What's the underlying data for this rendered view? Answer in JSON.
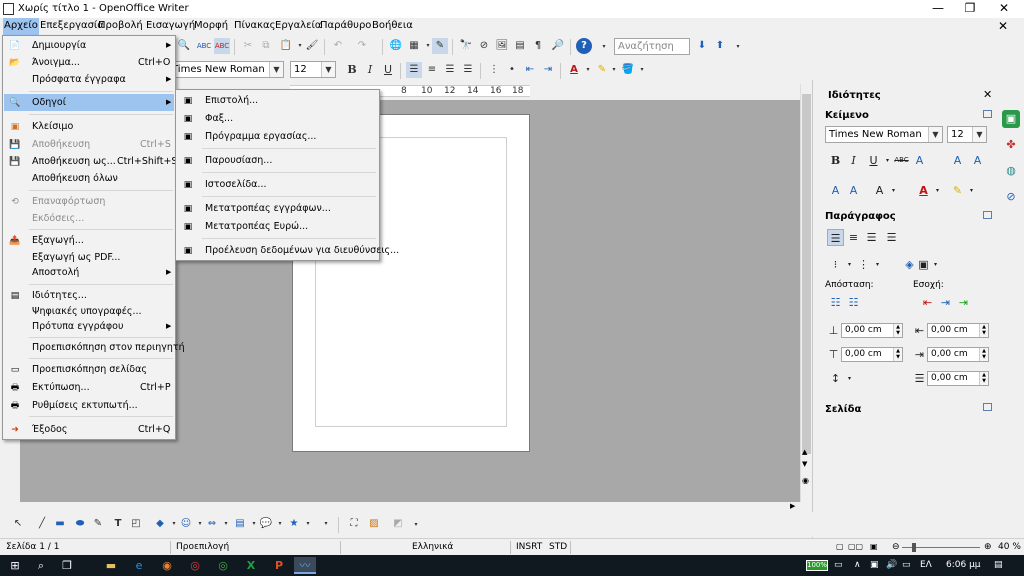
{
  "window": {
    "title": "Χωρίς τίτλο 1 - OpenOffice Writer",
    "minimize_label": "—",
    "maximize_label": "❐",
    "close_label": "✕",
    "doc_close_label": "✕"
  },
  "menubar": {
    "items": [
      "Αρχείο",
      "Επεξεργασία",
      "Προβολή",
      "Εισαγωγή",
      "Μορφή",
      "Πίνακας",
      "Εργαλεία",
      "Παράθυρο",
      "Βοήθεια"
    ]
  },
  "toolbar": {
    "find_placeholder": "Αναζήτηση",
    "font_name": "Times New Roman",
    "font_size": "12",
    "bold_label": "B",
    "italic_label": "I",
    "underline_label": "U"
  },
  "ruler": {
    "ticks": [
      "8",
      "10",
      "12",
      "14",
      "16",
      "18"
    ]
  },
  "file_menu": {
    "items": [
      {
        "label": "Δημιουργία",
        "shortcut": "",
        "arrow": true,
        "disabled": false
      },
      {
        "label": "Άνοιγμα...",
        "shortcut": "Ctrl+O",
        "arrow": false,
        "disabled": false
      },
      {
        "label": "Πρόσφατα έγγραφα",
        "shortcut": "",
        "arrow": true,
        "disabled": false
      },
      {
        "label": "Οδηγοί",
        "shortcut": "",
        "arrow": true,
        "disabled": false,
        "highlighted": true
      },
      {
        "label": "Κλείσιμο",
        "shortcut": "",
        "arrow": false,
        "disabled": false
      },
      {
        "label": "Αποθήκευση",
        "shortcut": "Ctrl+S",
        "arrow": false,
        "disabled": true
      },
      {
        "label": "Αποθήκευση ως...",
        "shortcut": "Ctrl+Shift+S",
        "arrow": false,
        "disabled": false
      },
      {
        "label": "Αποθήκευση όλων",
        "shortcut": "",
        "arrow": false,
        "disabled": false
      },
      {
        "label": "Επαναφόρτωση",
        "shortcut": "",
        "arrow": false,
        "disabled": true
      },
      {
        "label": "Εκδόσεις...",
        "shortcut": "",
        "arrow": false,
        "disabled": true
      },
      {
        "label": "Εξαγωγή...",
        "shortcut": "",
        "arrow": false,
        "disabled": false
      },
      {
        "label": "Εξαγωγή ως PDF...",
        "shortcut": "",
        "arrow": false,
        "disabled": false
      },
      {
        "label": "Αποστολή",
        "shortcut": "",
        "arrow": true,
        "disabled": false
      },
      {
        "label": "Ιδιότητες...",
        "shortcut": "",
        "arrow": false,
        "disabled": false
      },
      {
        "label": "Ψηφιακές υπογραφές...",
        "shortcut": "",
        "arrow": false,
        "disabled": false
      },
      {
        "label": "Πρότυπα εγγράφου",
        "shortcut": "",
        "arrow": true,
        "disabled": false
      },
      {
        "label": "Προεπισκόπηση στον περιηγητή",
        "shortcut": "",
        "arrow": false,
        "disabled": false
      },
      {
        "label": "Προεπισκόπηση σελίδας",
        "shortcut": "",
        "arrow": false,
        "disabled": false
      },
      {
        "label": "Εκτύπωση...",
        "shortcut": "Ctrl+P",
        "arrow": false,
        "disabled": false
      },
      {
        "label": "Ρυθμίσεις εκτυπωτή...",
        "shortcut": "",
        "arrow": false,
        "disabled": false
      },
      {
        "label": "Έξοδος",
        "shortcut": "Ctrl+Q",
        "arrow": false,
        "disabled": false
      }
    ]
  },
  "wizards_menu": {
    "items": [
      {
        "label": "Επιστολή..."
      },
      {
        "label": "Φαξ..."
      },
      {
        "label": "Πρόγραμμα εργασίας..."
      },
      {
        "label": "Παρουσίαση..."
      },
      {
        "label": "Ιστοσελίδα..."
      },
      {
        "label": "Μετατροπέας εγγράφων..."
      },
      {
        "label": "Μετατροπέας Ευρώ..."
      },
      {
        "label": "Προέλευση δεδομένων για διευθύνσεις..."
      }
    ]
  },
  "sidebar": {
    "title": "Ιδιότητες",
    "close_label": "✕",
    "text_section": "Κείμενο",
    "font_name": "Times New Roman",
    "font_size": "12",
    "paragraph_section": "Παράγραφος",
    "spacing_label": "Απόσταση:",
    "indent_label": "Εσοχή:",
    "spacing_above": "0,00 cm",
    "spacing_below": "0,00 cm",
    "indent_before": "0,00 cm",
    "indent_after": "0,00 cm",
    "indent_first": "0,00 cm",
    "page_section": "Σελίδα"
  },
  "statusbar": {
    "page": "Σελίδα 1 / 1",
    "style": "Προεπιλογή",
    "language": "Ελληνικά",
    "insert_mode": "INSRT",
    "selection_mode": "STD",
    "zoom": "40 %"
  },
  "taskbar": {
    "battery": "100%",
    "language": "ΕΛ",
    "time": "6:06 μμ"
  }
}
